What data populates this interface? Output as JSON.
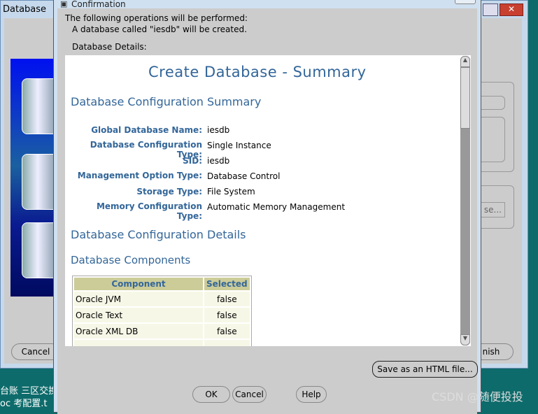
{
  "bg_window": {
    "title": "Database",
    "cancel": "Cancel",
    "finish": "nish",
    "browse": "se...",
    "taskbar": [
      "台账 三区交换机",
      "oc  考配置.t"
    ]
  },
  "dialog": {
    "title": "Confirmation",
    "intro": "The following operations will be performed:",
    "sub": "A database called \"iesdb\" will be created.",
    "details_label": "Database Details:",
    "summary_title": "Create Database - Summary",
    "config_summary_heading": "Database Configuration Summary",
    "fields": [
      {
        "label": "Global Database Name:",
        "value": "iesdb"
      },
      {
        "label": "Database Configuration Type:",
        "value": "Single Instance"
      },
      {
        "label": "SID:",
        "value": "iesdb"
      },
      {
        "label": "Management Option Type:",
        "value": "Database Control"
      },
      {
        "label": "Storage Type:",
        "value": "File System"
      },
      {
        "label": "Memory Configuration Type:",
        "value": "Automatic Memory Management"
      }
    ],
    "config_details_heading": "Database Configuration Details",
    "components_heading": "Database Components",
    "table": {
      "headers": [
        "Component",
        "Selected"
      ],
      "rows": [
        [
          "Oracle JVM",
          "false"
        ],
        [
          "Oracle Text",
          "false"
        ],
        [
          "Oracle XML DB",
          "false"
        ],
        [
          "",
          ""
        ]
      ]
    },
    "save_button": "Save as an HTML file...",
    "ok": "OK",
    "cancel": "Cancel",
    "help": "Help"
  },
  "watermark": "CSDN @随便投投"
}
